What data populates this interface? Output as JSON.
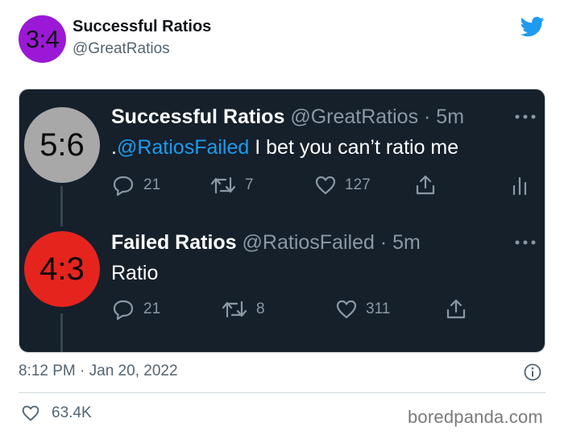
{
  "tweet": {
    "avatar_text": "3:4",
    "avatar_color": "#9b19d6",
    "author_name": "Successful Ratios",
    "author_handle": "@GreatRatios",
    "platform_icon": "twitter-bird-icon",
    "brand_color": "#1d9bf0",
    "timestamp": "8:12 PM · Jan 20, 2022",
    "likes": "63.4K"
  },
  "embedded": {
    "background": "#15202b",
    "tweets": [
      {
        "avatar_text": "5:6",
        "avatar_color": "#a8a8a8",
        "name": "Successful Ratios",
        "meta": "@GreatRatios · 5m",
        "text_prefix": ".",
        "mention": "@RatiosFailed",
        "text_rest": " I bet you can’t ratio me",
        "replies": "21",
        "retweets": "7",
        "likes": "127"
      },
      {
        "avatar_text": "4:3",
        "avatar_color": "#e5241e",
        "name": "Failed Ratios",
        "meta": "@RatiosFailed · 5m",
        "text": "Ratio",
        "replies": "21",
        "retweets": "8",
        "likes": "311"
      }
    ]
  },
  "watermark": "boredpanda.com"
}
